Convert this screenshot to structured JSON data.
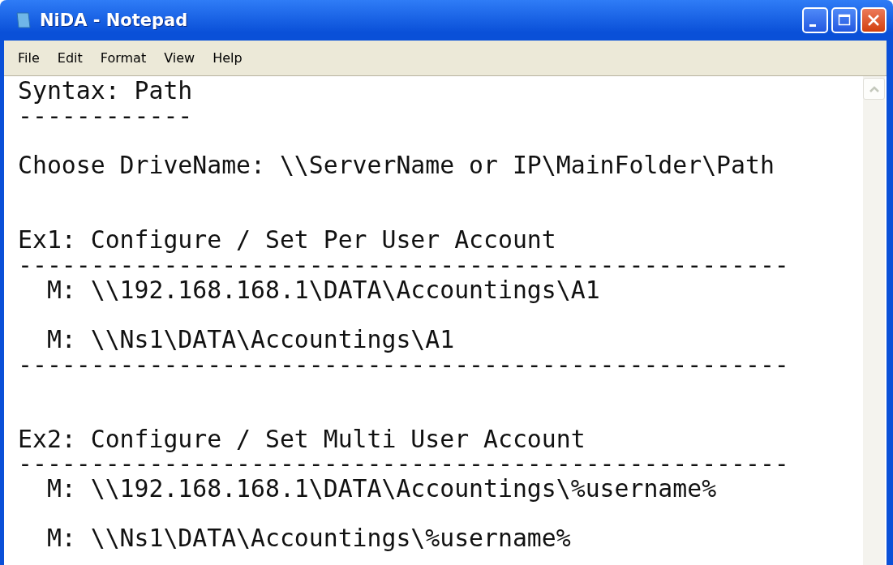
{
  "window": {
    "title": "NiDA - Notepad"
  },
  "menu": [
    {
      "label": "File"
    },
    {
      "label": "Edit"
    },
    {
      "label": "Format"
    },
    {
      "label": "View"
    },
    {
      "label": "Help"
    }
  ],
  "document": {
    "lines": [
      {
        "kind": "text",
        "text": "Syntax: Path"
      },
      {
        "kind": "text",
        "text": "------------"
      },
      {
        "kind": "blank"
      },
      {
        "kind": "text",
        "text": "Choose DriveName: \\\\ServerName or IP\\MainFolder\\Path"
      },
      {
        "kind": "blank"
      },
      {
        "kind": "blank"
      },
      {
        "kind": "text",
        "text": "Ex1: Configure / Set Per User Account"
      },
      {
        "kind": "text",
        "text": "-----------------------------------------------------"
      },
      {
        "kind": "text",
        "text": "  M: \\\\192.168.168.1\\DATA\\Accountings\\A1"
      },
      {
        "kind": "blank"
      },
      {
        "kind": "text",
        "text": "  M: \\\\Ns1\\DATA\\Accountings\\A1"
      },
      {
        "kind": "text",
        "text": "-----------------------------------------------------"
      },
      {
        "kind": "blank"
      },
      {
        "kind": "blank"
      },
      {
        "kind": "text",
        "text": "Ex2: Configure / Set Multi User Account"
      },
      {
        "kind": "text",
        "text": "-----------------------------------------------------"
      },
      {
        "kind": "text",
        "text": "  M: \\\\192.168.168.1\\DATA\\Accountings\\%username%"
      },
      {
        "kind": "blank"
      },
      {
        "kind": "text",
        "text": "  M: \\\\Ns1\\DATA\\Accountings\\%username%"
      }
    ]
  }
}
